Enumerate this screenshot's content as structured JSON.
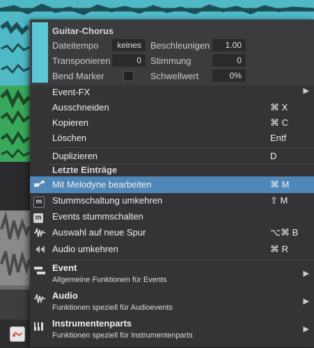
{
  "header": {
    "title": "Guitar-Chorus",
    "rows": [
      {
        "label1": "Dateitempo",
        "value1": "keines",
        "label2": "Beschleunigen",
        "value2": "1.00"
      },
      {
        "label1": "Transponieren",
        "value1": "0",
        "label2": "Stimmung",
        "value2": "0"
      },
      {
        "label1": "Bend Marker",
        "checkbox": false,
        "label2": "Schwellwert",
        "value2": "0%"
      }
    ]
  },
  "menu": {
    "items": [
      {
        "label": "Event-FX",
        "shortcut": "",
        "submenu": true
      },
      {
        "label": "Ausschneiden",
        "shortcut": "⌘ X"
      },
      {
        "label": "Kopieren",
        "shortcut": "⌘ C"
      },
      {
        "label": "Löschen",
        "shortcut": "Entf"
      },
      {
        "label": "Duplizieren",
        "shortcut": "D"
      }
    ],
    "recent_title": "Letzte Einträge",
    "recent": [
      {
        "label": "Mit Melodyne bearbeiten",
        "shortcut": "⌘ M",
        "icon": "melodyne-icon",
        "highlighted": true
      },
      {
        "label": "Stummschaltung umkehren",
        "shortcut": "⇧ M",
        "icon": "mute-invert-icon"
      },
      {
        "label": "Events stummschalten",
        "shortcut": "",
        "icon": "mute-icon"
      },
      {
        "label": "Auswahl auf neue Spur",
        "shortcut": "⌥⌘ B",
        "icon": "waveform-icon"
      },
      {
        "label": "Audio umkehren",
        "shortcut": "⌘ R",
        "icon": "reverse-icon"
      }
    ],
    "submenus": [
      {
        "title": "Event",
        "desc": "Allgemeine Funktionen für Events",
        "icon": "event-icon"
      },
      {
        "title": "Audio",
        "desc": "Funktionen speziell für Audioevents",
        "icon": "audio-icon"
      },
      {
        "title": "Instrumentenparts",
        "desc": "Funktionen speziell für Instrumentenparts",
        "icon": "instrument-icon"
      }
    ]
  },
  "glyphs": {
    "submenu_arrow": "▶",
    "mute_box": "m",
    "mute_box_bold": "m"
  },
  "colors": {
    "accent": "#5cc8d6",
    "highlight": "#4f87b8",
    "menu_bg": "#343436"
  }
}
